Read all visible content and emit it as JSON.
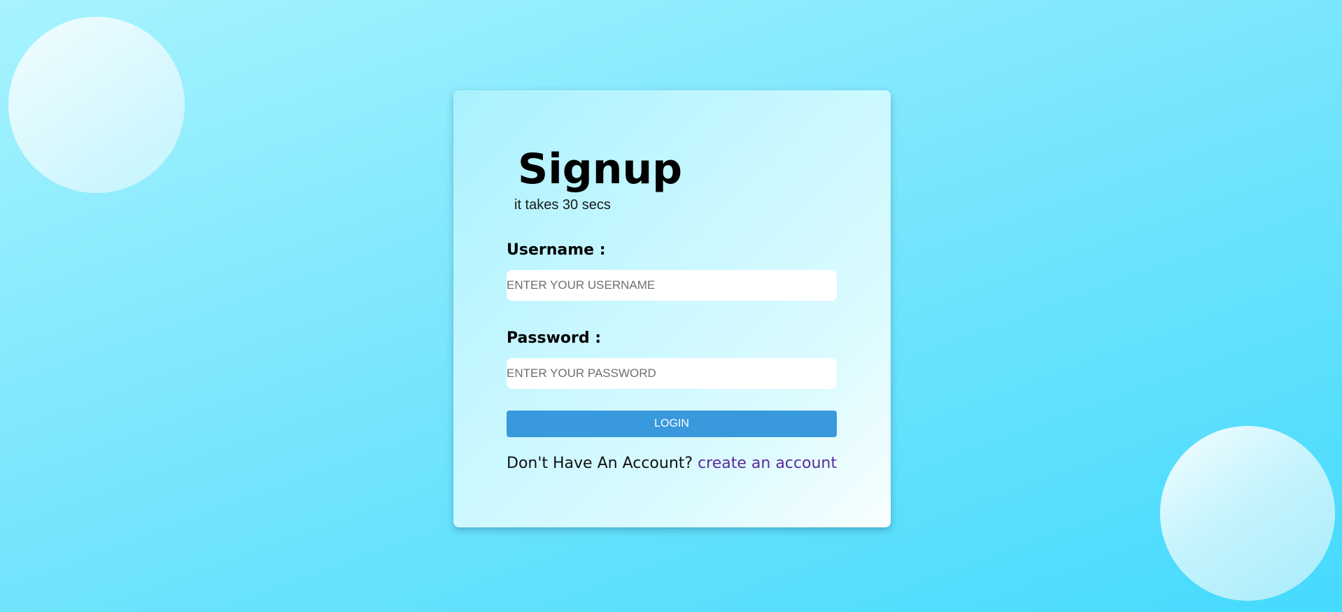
{
  "signup": {
    "title": "Signup",
    "subtitle": "it takes 30 secs"
  },
  "form": {
    "username_label": "Username :",
    "username_placeholder": "ENTER YOUR USERNAME",
    "username_value": "",
    "password_label": "Password :",
    "password_placeholder": "ENTER YOUR PASSWORD",
    "password_value": "",
    "login_label": "LOGIN"
  },
  "footer": {
    "prompt": "Don't Have An Account?",
    "link_label": "create an account"
  },
  "colors": {
    "background_start": "#a7f3ff",
    "background_end": "#45dafe",
    "button": "#3899dc",
    "link": "#5b2a9c"
  }
}
